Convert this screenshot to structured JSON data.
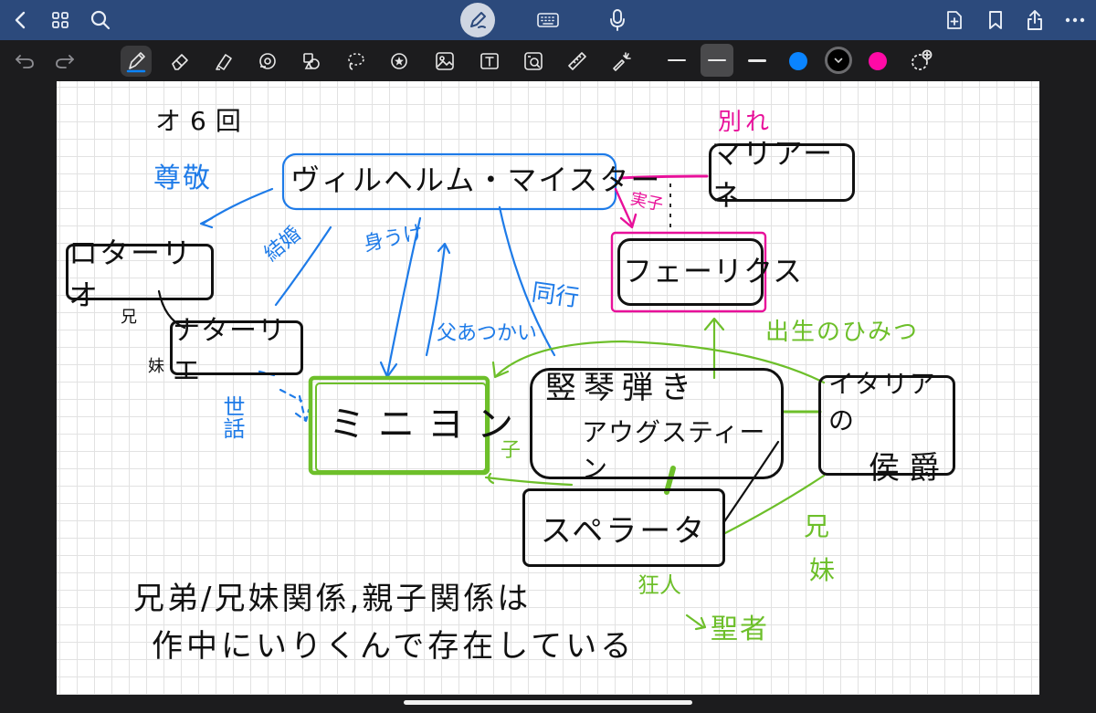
{
  "app": {
    "top_icons": [
      "back-chevron-icon",
      "thumbnails-grid-icon",
      "search-icon",
      "pen-mode-icon",
      "keyboard-icon",
      "microphone-icon",
      "add-page-icon",
      "bookmark-icon",
      "share-icon",
      "more-icon"
    ],
    "tools": [
      "undo-icon",
      "redo-icon",
      "pen-tool-icon",
      "eraser-tool-icon",
      "highlighter-tool-icon",
      "shapes-tool-icon",
      "elements-tool-icon",
      "lasso-tool-icon",
      "sticker-tool-icon",
      "image-tool-icon",
      "text-tool-icon",
      "camera-scan-icon",
      "ruler-tool-icon",
      "laser-pointer-icon"
    ],
    "colors": {
      "blue": "#0a84ff",
      "black": "#000000",
      "magenta": "#ff0aa6"
    }
  },
  "note": {
    "title": "オ6回",
    "nodes": {
      "wilhelm": "ヴィルヘルム・マイスター",
      "mariane": "マリアーネ",
      "felix": "フェーリクス",
      "lothario": "ロターリオ",
      "natalie": "ナターリエ",
      "mignon": "ミニヨン",
      "harper": "竪琴弾き",
      "augustin": "アウグスティーン",
      "sperata": "スペラータ",
      "marchese": "イタリアの",
      "marchese2": "侯爵"
    },
    "labels": {
      "wakare": "別れ",
      "jitsuko": "実子",
      "sonkei": "尊敬",
      "kekkon": "結婚",
      "miuke": "身うけ",
      "oyaatsukai": "父あつかい",
      "doukou": "同行",
      "ani": "兄",
      "imouto": "妹",
      "sewa": "世話",
      "ko": "子",
      "shussei": "出生のひみつ",
      "ani2": "兄",
      "imouto2": "妹",
      "kyoujin": "狂人",
      "seija": "聖者"
    },
    "footer_line1": "兄弟/兄妹関係,親子関係は",
    "footer_line2": "作中にいりくんで存在している"
  }
}
